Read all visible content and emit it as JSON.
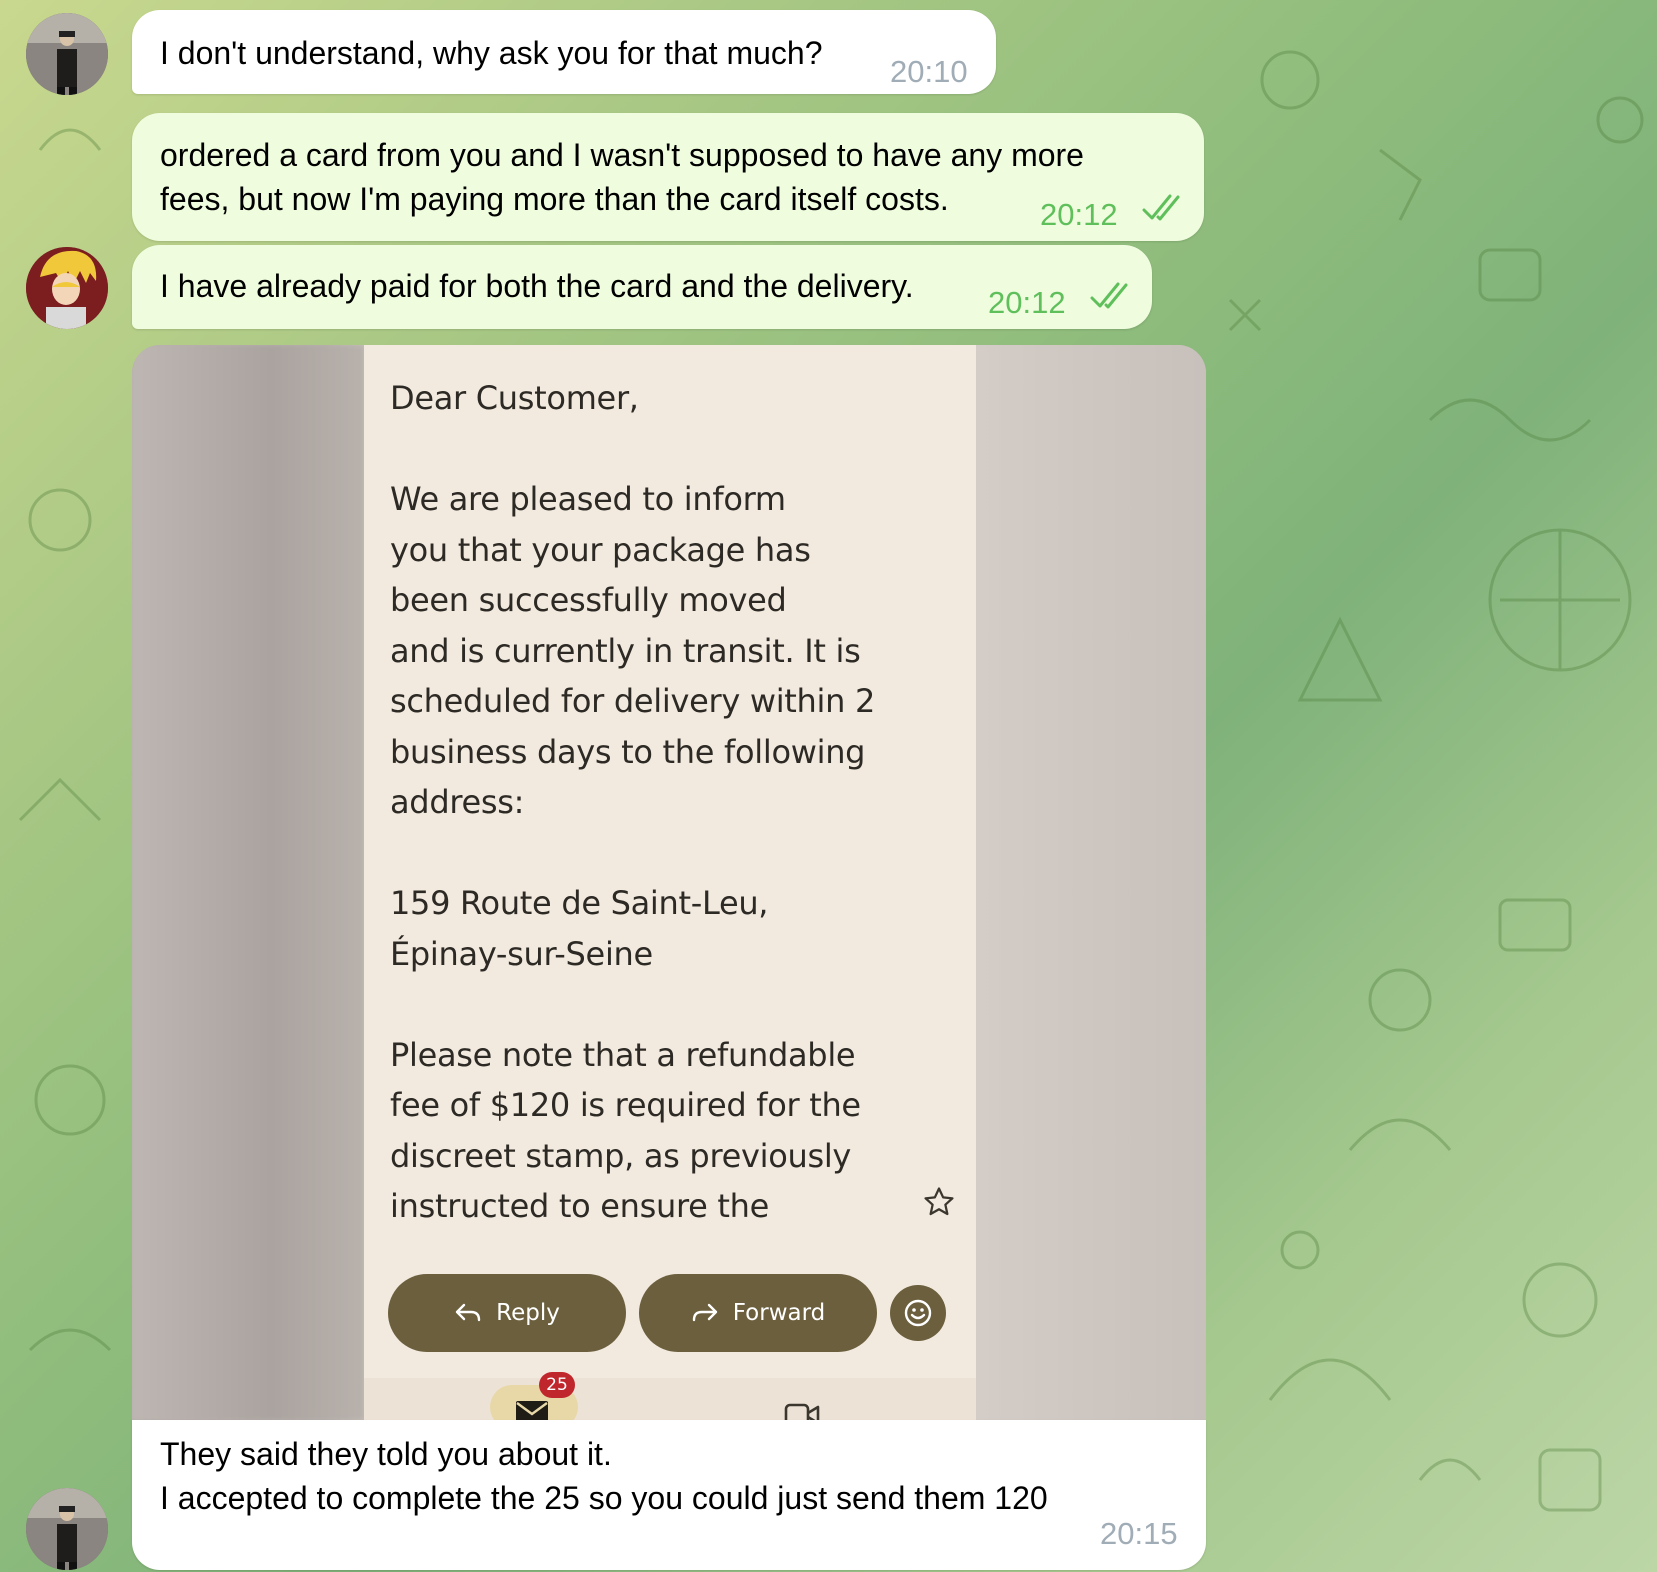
{
  "messages": [
    {
      "text": "I don't understand, why ask you for that much?",
      "time": "20:10"
    },
    {
      "text": "ordered a card from you and I wasn't supposed to have any more\nfees, but now I'm paying more than the card itself costs.",
      "time": "20:12"
    },
    {
      "text": "I have already paid for both the card and the delivery.",
      "time": "20:12"
    },
    {
      "text": "They said they told you about it.\nI accepted to complete the 25 so you could just send them 120",
      "time": "20:15"
    }
  ],
  "screenshot_email": {
    "body": "Dear Customer,\n\nWe are pleased to inform\nyou that your package has\nbeen successfully moved\nand is currently in transit. It is\nscheduled for delivery within 2\nbusiness days to the following\naddress:\n\n159 Route de Saint-Leu,\nÉpinay-sur-Seine\n\nPlease note that a refundable\nfee of $120 is required for the\ndiscreet stamp, as previously\ninstructed to ensure the",
    "reply_label": "Reply",
    "forward_label": "Forward",
    "inbox_badge": "25"
  },
  "colors": {
    "incoming_bubble": "#ffffff",
    "outgoing_bubble": "#effdde",
    "outgoing_time": "#5fbf5b",
    "incoming_time": "#a0acb6",
    "email_button": "#6b5f3d"
  },
  "icons": [
    "double-check-icon",
    "star-icon",
    "reply-arrow-icon",
    "forward-arrow-icon",
    "smiley-icon",
    "mail-icon",
    "video-icon"
  ]
}
